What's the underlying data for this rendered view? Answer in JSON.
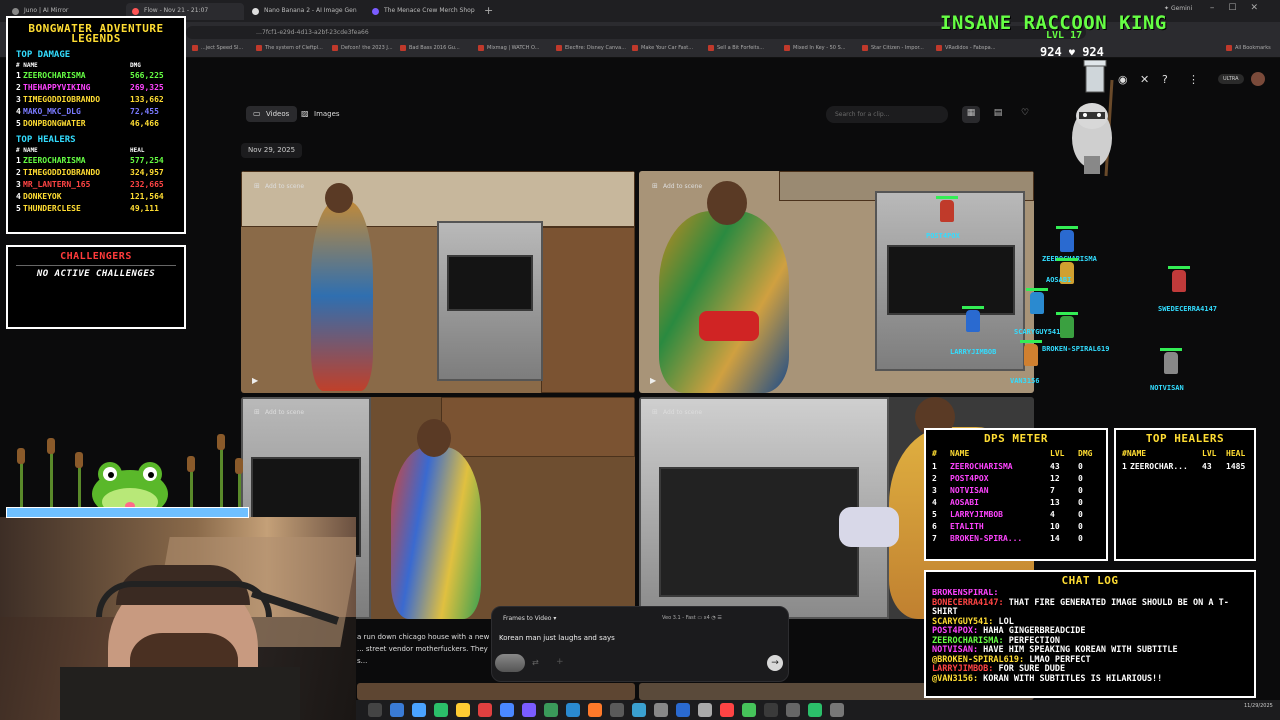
{
  "browser": {
    "tabs": [
      {
        "label": "Juno | AI Mirror",
        "color": "#888888"
      },
      {
        "label": "Flow - Nov 21 - 21:07",
        "color": "#ff5555"
      },
      {
        "label": "Nano Banana 2 - AI Image Gen",
        "color": "#dddddd"
      },
      {
        "label": "The Menace Crew Merch Shop",
        "color": "#7a5cff"
      }
    ],
    "gemini_label": "Gemini",
    "url": "…7fcf1-e29d-4d13-a2bf-23cde3fea66",
    "bookmarks": [
      "...ject Speed Sl...",
      "The system of Cleftpl...",
      "Defcon! the 2023 J...",
      "Bad Bass 2016 Gu...",
      "Mixmag | WATCH O...",
      "Elecfire: Disney Canva...",
      "Make Your Car Fast...",
      "Sell a Bit Forfeits...",
      "Mixed In Key - 50 S...",
      "Star Citizen - Impor...",
      "VRadidos - Fabspa...",
      "All Bookmarks"
    ]
  },
  "app": {
    "header_icons": [
      "discord-icon",
      "x-icon",
      "help-icon",
      "more-icon"
    ],
    "plan_badge": "ULTRA",
    "filters": {
      "videos": "Videos",
      "images": "Images"
    },
    "search_placeholder": "Search for a clip...",
    "date_label": "Nov 29, 2025",
    "tiles": [
      {
        "add_label": "Add to scene"
      },
      {
        "add_label": "Add to scene"
      },
      {
        "add_label": "Add to scene"
      },
      {
        "add_label": "Add to scene"
      }
    ],
    "prompt": {
      "mode": "Frames to Video",
      "model": "Veo 3.1 - Fast",
      "count": "x4",
      "text": "Korean man just laughs and says"
    },
    "behind_prompt_text": "a run down chicago house with a new ... street vendor motherfuckers. They s..."
  },
  "taskbar": {
    "time": "",
    "date": "11/29/2025"
  },
  "overlay": {
    "king": {
      "title": "INSANE RACCOON KING",
      "level": "LVL 17",
      "hp": "924",
      "hp_max": "924"
    },
    "leaderboard": {
      "title_line1": "BONGWATER ADVENTURE",
      "title_line2": "LEGENDS",
      "damage_title": "TOP DAMAGE",
      "damage_cols": {
        "name": "# NAME",
        "value": "DMG"
      },
      "damage": [
        {
          "rank": "1",
          "name": "ZEEROCHARISMA",
          "value": "566,225",
          "color": "#66ff44"
        },
        {
          "rank": "2",
          "name": "THEHAPPYVIKING",
          "value": "269,325",
          "color": "#ff44ff"
        },
        {
          "rank": "3",
          "name": "TIMEGODDIOBRANDO",
          "value": "133,662",
          "color": "#ffdd33"
        },
        {
          "rank": "4",
          "name": "MAKO_MKC_DLG",
          "value": "72,455",
          "color": "#7a7aff"
        },
        {
          "rank": "5",
          "name": "DONPBONGWATER",
          "value": "46,466",
          "color": "#ffdd33"
        }
      ],
      "healers_title": "TOP HEALERS",
      "healers_cols": {
        "name": "# NAME",
        "value": "HEAL"
      },
      "healers": [
        {
          "rank": "1",
          "name": "ZEEROCHARISMA",
          "value": "577,254",
          "color": "#66ff44"
        },
        {
          "rank": "2",
          "name": "TIMEGODDIOBRANDO",
          "value": "324,957",
          "color": "#ffdd33"
        },
        {
          "rank": "3",
          "name": "MR_LANTERN_165",
          "value": "232,665",
          "color": "#ff4444"
        },
        {
          "rank": "4",
          "name": "DONKEYOK",
          "value": "121,564",
          "color": "#ffdd33"
        },
        {
          "rank": "5",
          "name": "THUNDERCLESE",
          "value": "49,111",
          "color": "#ffdd33"
        }
      ]
    },
    "challengers": {
      "title": "CHALLENGERS",
      "status": "NO ACTIVE CHALLENGES"
    },
    "dps_meter": {
      "title": "DPS METER",
      "cols": {
        "rank": "#",
        "name": "NAME",
        "lvl": "LVL",
        "dmg": "DMG"
      },
      "rows": [
        {
          "rank": "1",
          "name": "ZEEROCHARISMA",
          "lvl": "43",
          "dmg": "0",
          "color": "#ff44ff"
        },
        {
          "rank": "2",
          "name": "POST4POX",
          "lvl": "12",
          "dmg": "0",
          "color": "#ff44ff"
        },
        {
          "rank": "3",
          "name": "NOTVISAN",
          "lvl": "7",
          "dmg": "0",
          "color": "#ff44ff"
        },
        {
          "rank": "4",
          "name": "AOSABI",
          "lvl": "13",
          "dmg": "0",
          "color": "#ff44ff"
        },
        {
          "rank": "5",
          "name": "LARRYJIMBOB",
          "lvl": "4",
          "dmg": "0",
          "color": "#ff44ff"
        },
        {
          "rank": "6",
          "name": "ETALITH",
          "lvl": "10",
          "dmg": "0",
          "color": "#ff44ff"
        },
        {
          "rank": "7",
          "name": "BROKEN-SPIRA...",
          "lvl": "14",
          "dmg": "0",
          "color": "#ff44ff"
        }
      ]
    },
    "top_healers": {
      "title": "TOP HEALERS",
      "cols": {
        "name": "#NAME",
        "lvl": "LVL",
        "heal": "HEAL"
      },
      "rows": [
        {
          "rank": "1",
          "name": "ZEEROCHAR...",
          "lvl": "43",
          "heal": "1485"
        }
      ]
    },
    "chat_log": {
      "title": "CHAT LOG",
      "messages": [
        {
          "user": "BROKENSPIRAL:",
          "text": "",
          "color": "#ff44ff"
        },
        {
          "user": "BONECERRA4147:",
          "text": "THAT FIRE GENERATED IMAGE SHOULD BE ON A T-SHIRT",
          "color": "#ff4444"
        },
        {
          "user": "SCARYGUY541:",
          "text": "LOL",
          "color": "#ffdd33"
        },
        {
          "user": "POST4POX:",
          "text": "HAHA GINGERBREADCIDE",
          "color": "#ff44ff"
        },
        {
          "user": "ZEEROCHARISMA:",
          "text": "PERFECTION",
          "color": "#66ff44"
        },
        {
          "user": "NOTVISAN:",
          "text": "HAVE HIM SPEAKING KOREAN WITH SUBTITLE",
          "color": "#ff44ff"
        },
        {
          "user": "@BROKEN-SPIRAL619:",
          "text": "LMAO PERFECT",
          "color": "#ffdd33"
        },
        {
          "user": "LARRYJIMBOB:",
          "text": "FOR SURE DUDE",
          "color": "#ff4444"
        },
        {
          "user": "@VAN3156:",
          "text": "KORAN WITH SUBTITLES IS HILARIOUS!!",
          "color": "#ffdd33"
        }
      ]
    },
    "players": [
      {
        "name": "POST4POX"
      },
      {
        "name": "ZEEROCHARISMA"
      },
      {
        "name": "AOSABI"
      },
      {
        "name": "SWEDECERRA4147"
      },
      {
        "name": "SCARYGUY541"
      },
      {
        "name": "LARRYJIMBOB"
      },
      {
        "name": "BROKEN-SPIRAL619"
      },
      {
        "name": "VAN3156"
      },
      {
        "name": "NOTVISAN"
      }
    ]
  }
}
